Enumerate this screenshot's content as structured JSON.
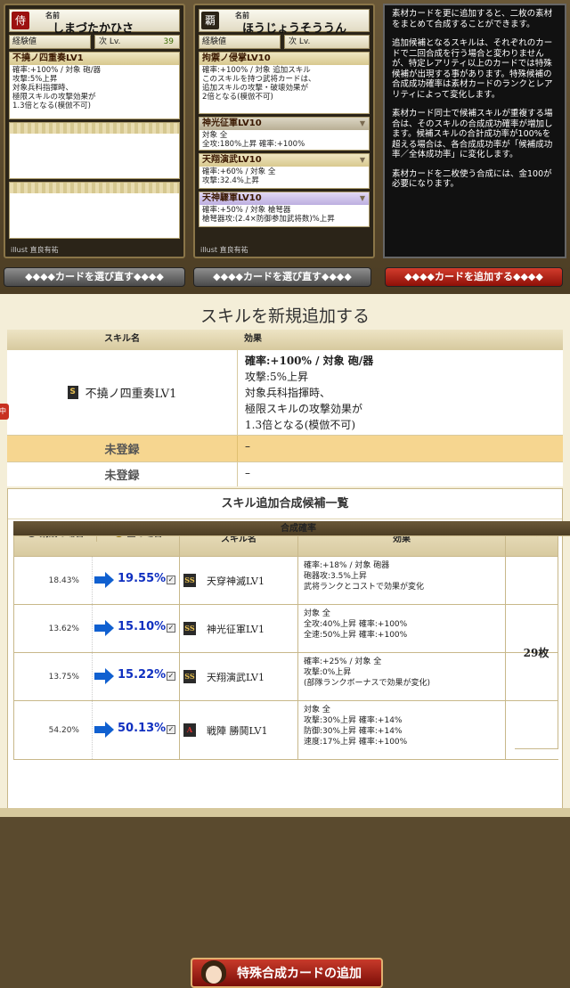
{
  "card1": {
    "name_label": "名前",
    "name": "しまづたかひさ",
    "exp_label": "経験値",
    "lv_label": "次 Lv.",
    "lv_value": "39",
    "skill1_title": "不撓ノ四重奏LV1",
    "skill1_body": [
      "確率:+100% / 対象 砲/器",
      "攻撃:5%上昇",
      "対象兵科指揮時、",
      "極限スキルの攻撃効果が",
      "1.3倍となる(模倣不可)"
    ],
    "illust": "illust 直良有祐"
  },
  "card2": {
    "name_label": "名前",
    "name": "ほうじょうそううん",
    "exp_label": "経験値",
    "lv_label": "次 Lv.",
    "skill1_title": "拘禦ノ侵掌LV10",
    "skill1_body": [
      "確率:+100% / 対象 追加スキル",
      "このスキルを持つ武将カードは、",
      "追加スキルの攻撃・破壊効果が",
      "2倍となる(模倣不可)"
    ],
    "skill2_title": "神光征軍LV10",
    "skill2_body": [
      "対象 全",
      "全攻:180%上昇 確率:+100%"
    ],
    "skill3_title": "天翔演武LV10",
    "skill3_body": [
      "確率:+60% / 対象 全",
      "攻撃:32.4%上昇"
    ],
    "skill4_title": "天神驟軍LV10",
    "skill4_body": [
      "確率:+50% / 対象 槍弩器",
      "槍弩器攻:(2.4×防御参加武将数)%上昇"
    ],
    "illust": "illust 直良有祐"
  },
  "info": {
    "paragraphs": [
      "素材カードを更に追加すると、二枚の素材をまとめて合成することができます。",
      "追加候補となるスキルは、それぞれのカードで二回合成を行う場合と変わりませんが、特定レアリティ以上のカードでは特殊候補が出現する事があります。特殊候補の合成成功確率は素材カードのランクとレアリティによって変化します。",
      "素材カード同士で候補スキルが重複する場合は、そのスキルの合成成功確率が増加します。候補スキルの合計成功率が100%を超える場合は、各合成成功率が「候補成功率／全体成功率」に変化します。",
      "素材カードを二枚使う合成には、金100が必要になります。"
    ]
  },
  "buttons": {
    "reselect1": "カードを選び直す",
    "reselect2": "カードを選び直す",
    "add_card": "カードを追加する"
  },
  "main": {
    "title": "スキルを新規追加する",
    "col_name": "スキル名",
    "col_effect": "効果",
    "rows": [
      {
        "icon": "S",
        "name": "不撓ノ四重奏LV1",
        "effect": [
          "確率:+100% / 対象 砲/器",
          "攻撃:5%上昇",
          "対象兵科指揮時、",
          "極限スキルの攻撃効果が",
          "1.3倍となる(模倣不可)"
        ]
      },
      {
        "name": "未登録",
        "effect": [
          "–"
        ]
      },
      {
        "name": "未登録",
        "effect": [
          "–"
        ]
      }
    ],
    "tab_marker": "中"
  },
  "candidates": {
    "title": "スキル追加合成候補一覧",
    "h_rate": "合成確率",
    "h_cu": "銅銭の場合",
    "h_au": "金の場合",
    "h_name": "スキル名",
    "h_effect": "効果",
    "h_piece": "天下の片鱗",
    "piece_value": "29枚",
    "rows": [
      {
        "cu": "18.43%",
        "au": "19.55%",
        "rank": "SS",
        "name": "天穿神滅LV1",
        "effect": [
          "確率:+18% / 対象 砲器",
          "砲器攻:3.5%上昇",
          "武将ランクとコストで効果が変化"
        ]
      },
      {
        "cu": "13.62%",
        "au": "15.10%",
        "rank": "SS",
        "name": "神光征軍LV1",
        "effect": [
          "対象 全",
          "全攻:40%上昇 確率:+100%",
          "全速:50%上昇 確率:+100%"
        ]
      },
      {
        "cu": "13.75%",
        "au": "15.22%",
        "rank": "SS",
        "name": "天翔演武LV1",
        "effect": [
          "確率:+25% / 対象 全",
          "攻撃:0%上昇",
          "(部隊ランクボーナスで効果が変化)"
        ]
      },
      {
        "cu": "54.20%",
        "au": "50.13%",
        "rank": "A",
        "name": "戦陣 勝鬨LV1",
        "effect": [
          "対象 全",
          "攻撃:30%上昇 確率:+14%",
          "防御:30%上昇 確率:+14%",
          "速度:17%上昇 確率:+100%"
        ]
      }
    ],
    "special_button": "特殊合成カードの追加"
  }
}
